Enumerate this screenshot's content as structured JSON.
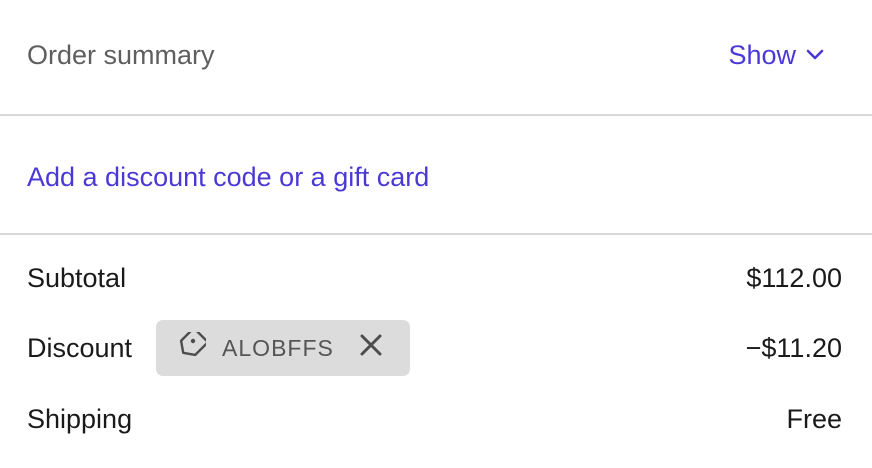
{
  "header": {
    "title": "Order summary",
    "toggle_label": "Show",
    "toggle_icon": "chevron-down-icon"
  },
  "discount": {
    "link_label": "Add a discount code or a gift card"
  },
  "summary": {
    "subtotal_label": "Subtotal",
    "subtotal_value": "$112.00",
    "discount_label": "Discount",
    "discount_code": "ALOBFFS",
    "discount_icon": "tag-icon",
    "remove_icon": "close-icon",
    "discount_value": "−$11.20",
    "shipping_label": "Shipping",
    "shipping_value": "Free"
  },
  "colors": {
    "accent": "#4b39d6",
    "divider": "#d9d9d9",
    "chip_bg": "#dcdcdc"
  }
}
